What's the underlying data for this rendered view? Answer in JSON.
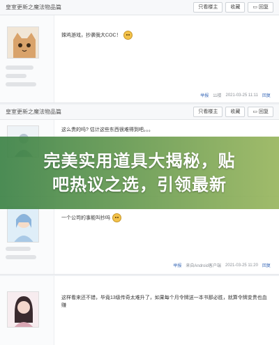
{
  "thread_title": "皇室更新之魔法物品篇",
  "toolbar": {
    "only_op": "只看楼主",
    "favorite": "收藏",
    "reply": "回复"
  },
  "posts": [
    {
      "text": "辣鸡游戏，抄袭我大COC！",
      "report": "举报",
      "floor": "11楼",
      "time": "2021-03-25 11:11",
      "reply_label": "回复"
    },
    {
      "text": "这么贵的吗? 估计这些东西很难得到吧。。。",
      "report": "",
      "floor": "",
      "time": "",
      "reply_label": ""
    },
    {
      "text": "一个公司的事能叫抄吗",
      "report": "举报",
      "floor": "来自Android客户端",
      "time": "2021-03-25 11:20",
      "reply_label": "回复"
    },
    {
      "text": "这样看来还不错，毕竟13级传奇太难升了，如果每个月令牌送一本书那必胜，就算令牌变贵也血赚",
      "report": "",
      "floor": "",
      "time": "",
      "reply_label": ""
    }
  ],
  "banner": {
    "line1": "完美实用道具大揭秘，贴",
    "line2": "吧热议之选，引领最新"
  },
  "icons": [
    "emoji-icon",
    "report-icon",
    "reply-icon"
  ]
}
